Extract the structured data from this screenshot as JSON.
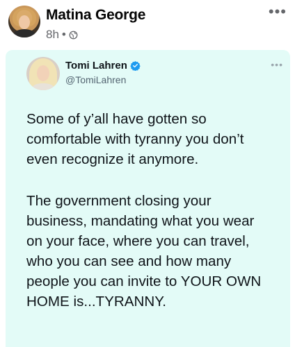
{
  "post": {
    "author_name": "Matina George",
    "time": "8h",
    "separator": "•",
    "privacy_icon": "globe-icon",
    "more_icon": "more-horizontal-icon",
    "more_label": "•••"
  },
  "tweet": {
    "name": "Tomi Lahren",
    "handle": "@TomiLahren",
    "verified_icon": "verified-badge-icon",
    "more_label": "•••",
    "colors": {
      "background": "#e3fbf7",
      "verified": "#1d9bf0"
    },
    "paragraphs": [
      {
        "lines": [
          "Some of y’all have gotten so",
          "comfortable with tyranny you don’t",
          "even recognize it anymore."
        ]
      },
      {
        "lines": [
          "The government closing your",
          "business, mandating what you wear",
          "on your face, where you can travel,",
          "who you can see and how many",
          "people you can invite to YOUR OWN",
          "HOME is...TYRANNY."
        ]
      }
    ]
  }
}
